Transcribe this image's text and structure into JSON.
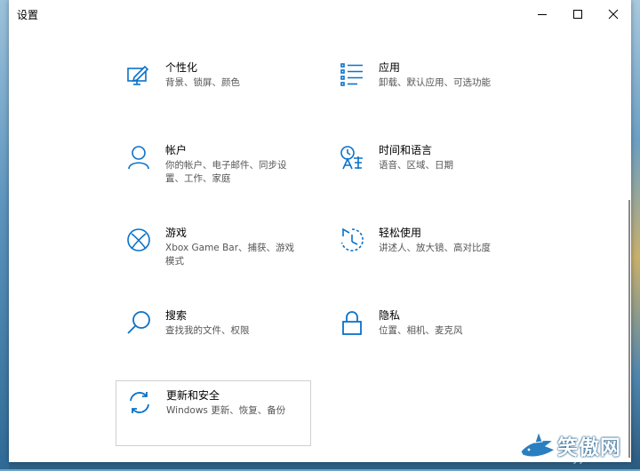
{
  "window": {
    "title": "设置"
  },
  "settings": [
    {
      "name": "个性化",
      "desc": "背景、锁屏、颜色",
      "icon": "personalization-icon"
    },
    {
      "name": "应用",
      "desc": "卸载、默认应用、可选功能",
      "icon": "apps-icon"
    },
    {
      "name": "帐户",
      "desc": "你的帐户、电子邮件、同步设置、工作、家庭",
      "icon": "accounts-icon"
    },
    {
      "name": "时间和语言",
      "desc": "语音、区域、日期",
      "icon": "time-language-icon"
    },
    {
      "name": "游戏",
      "desc": "Xbox Game Bar、捕获、游戏模式",
      "icon": "xbox-icon"
    },
    {
      "name": "轻松使用",
      "desc": "讲述人、放大镜、高对比度",
      "icon": "ease-of-access-icon"
    },
    {
      "name": "搜索",
      "desc": "查找我的文件、权限",
      "icon": "search-icon"
    },
    {
      "name": "隐私",
      "desc": "位置、相机、麦克风",
      "icon": "privacy-lock-icon"
    },
    {
      "name": "更新和安全",
      "desc": "Windows 更新、恢复、备份",
      "icon": "update-sync-icon"
    }
  ],
  "watermark": {
    "text": "笑傲网",
    "sub": "xajjn.com"
  },
  "colors": {
    "accent": "#0a72c9",
    "window_bg": "#ffffff"
  }
}
